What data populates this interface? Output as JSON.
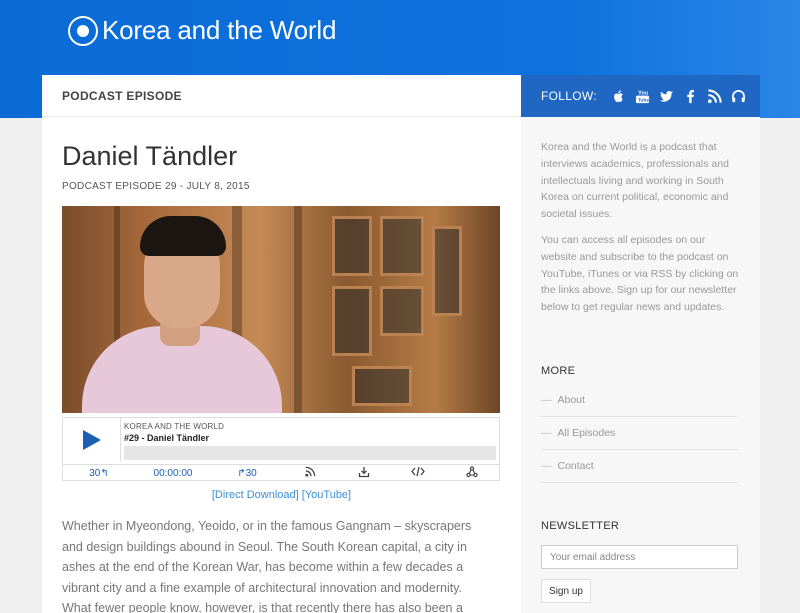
{
  "site": {
    "title": "Korea and the World"
  },
  "main": {
    "section_label": "PODCAST EPISODE",
    "episode_title": "Daniel Tändler",
    "episode_meta": "PODCAST EPISODE 29 - JULY 8, 2015"
  },
  "player": {
    "show_name": "KOREA AND THE WORLD",
    "episode_name": "#29 - Daniel Tändler",
    "rewind_label": "30↰",
    "time": "00:00:00",
    "forward_label": "↱30",
    "icons": [
      "rss-icon",
      "download-icon",
      "embed-icon",
      "share-icon"
    ]
  },
  "links": {
    "direct_download": "[Direct Download]",
    "youtube": "[YouTube]"
  },
  "body_text": "Whether in Myeondong, Yeoido, or in the famous Gangnam – skyscrapers and design buildings abound in Seoul. The South Korean capital, a city in ashes at the end of the Korean War, has become within a few decades a vibrant city and a fine example of architectural innovation and modernity. What fewer people know, however, is that recently there has also been a renewed interest in Korean",
  "sidebar": {
    "follow_label": "FOLLOW:",
    "follow_icons": [
      "apple-icon",
      "youtube-icon",
      "twitter-icon",
      "facebook-icon",
      "rss-icon",
      "headphones-icon"
    ],
    "about_p1": "Korea and the World is a podcast that interviews academics, professionals and intellectuals living and working in South Korea on current political, economic and societal issues.",
    "about_p2": "You can access all episodes on our website and subscribe to the podcast on YouTube, iTunes or via RSS by clicking on the links above. Sign up for our newsletter below to get regular news and updates.",
    "more_title": "MORE",
    "more_items": [
      {
        "label": "About"
      },
      {
        "label": "All Episodes"
      },
      {
        "label": "Contact"
      }
    ],
    "newsletter_title": "NEWSLETTER",
    "newsletter_placeholder": "Your email address",
    "signup_label": "Sign up"
  },
  "colors": {
    "brand_blue": "#0d72de",
    "follow_bar": "#1f67c3",
    "link_blue": "#3b8fd8"
  }
}
